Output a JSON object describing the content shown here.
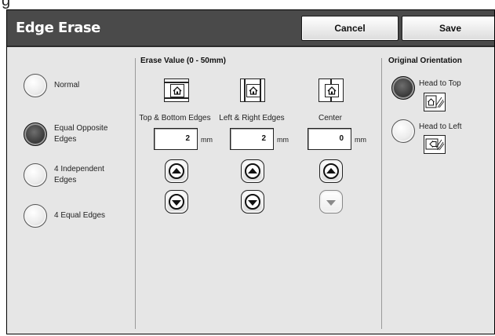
{
  "screen": {
    "title": "Edge Erase",
    "cancel_label": "Cancel",
    "save_label": "Save"
  },
  "erase_mode": {
    "options": [
      {
        "label": "Normal",
        "selected": false
      },
      {
        "label": "Equal Opposite Edges",
        "selected": true
      },
      {
        "label": "4 Independent Edges",
        "selected": false
      },
      {
        "label": "4 Equal Edges",
        "selected": false
      }
    ]
  },
  "erase_value": {
    "title": "Erase Value (0 - 50mm)",
    "unit": "mm",
    "columns": [
      {
        "label": "Top & Bottom Edges",
        "value": "2",
        "icon": "top-bottom-edge-icon",
        "down_enabled": true
      },
      {
        "label": "Left & Right Edges",
        "value": "2",
        "icon": "left-right-edge-icon",
        "down_enabled": true
      },
      {
        "label": "Center",
        "value": "0",
        "icon": "center-edge-icon",
        "down_enabled": false
      }
    ]
  },
  "orientation": {
    "title": "Original Orientation",
    "options": [
      {
        "label": "Head to Top",
        "selected": true
      },
      {
        "label": "Head to Left",
        "selected": false
      }
    ]
  },
  "fragment_text": "g"
}
